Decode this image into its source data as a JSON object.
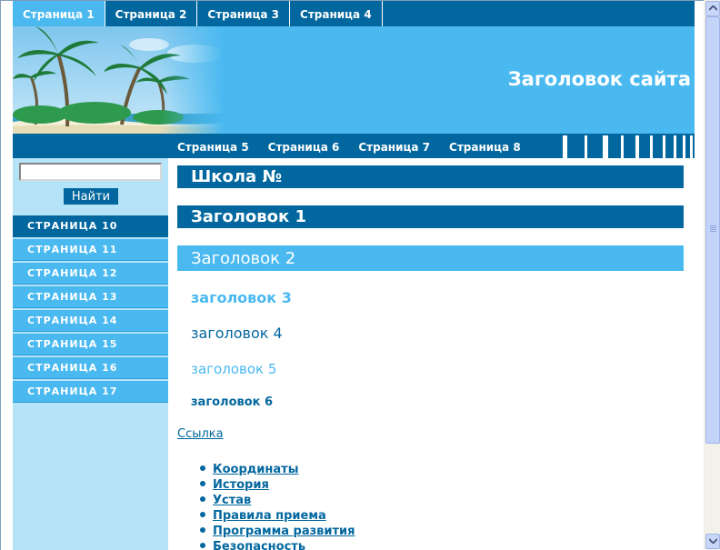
{
  "top_tabs": [
    {
      "label": "Страница 1",
      "active": true
    },
    {
      "label": "Страница 2",
      "active": false
    },
    {
      "label": "Страница 3",
      "active": false
    },
    {
      "label": "Страница 4",
      "active": false
    }
  ],
  "header": {
    "site_title": "Заголовок сайта"
  },
  "sub_nav": [
    "Страница 5",
    "Страница 6",
    "Страница 7",
    "Страница 8"
  ],
  "search": {
    "value": "",
    "button_label": "Найти"
  },
  "side_menu": [
    {
      "label": "СТРАНИЦА 10",
      "active": true
    },
    {
      "label": "СТРАНИЦА 11",
      "active": false
    },
    {
      "label": "СТРАНИЦА 12",
      "active": false
    },
    {
      "label": "СТРАНИЦА 13",
      "active": false
    },
    {
      "label": "СТРАНИЦА 14",
      "active": false
    },
    {
      "label": "СТРАНИЦА 15",
      "active": false
    },
    {
      "label": "СТРАНИЦА 16",
      "active": false
    },
    {
      "label": "СТРАНИЦА 17",
      "active": false
    }
  ],
  "content": {
    "school_title": "Школа №",
    "heading1": "Заголовок 1",
    "heading2": "Заголовок 2",
    "heading3": "заголовок 3",
    "heading4": "заголовок 4",
    "heading5": "заголовок 5",
    "heading6": "заголовок 6",
    "link": "Ссылка",
    "links": [
      "Координаты",
      "История",
      "Устав",
      "Правила приема",
      "Программа развития",
      "Безопасность"
    ]
  },
  "colors": {
    "dark_blue": "#02679e",
    "light_blue": "#4ab9f0",
    "pale_blue": "#b5e3f8"
  }
}
